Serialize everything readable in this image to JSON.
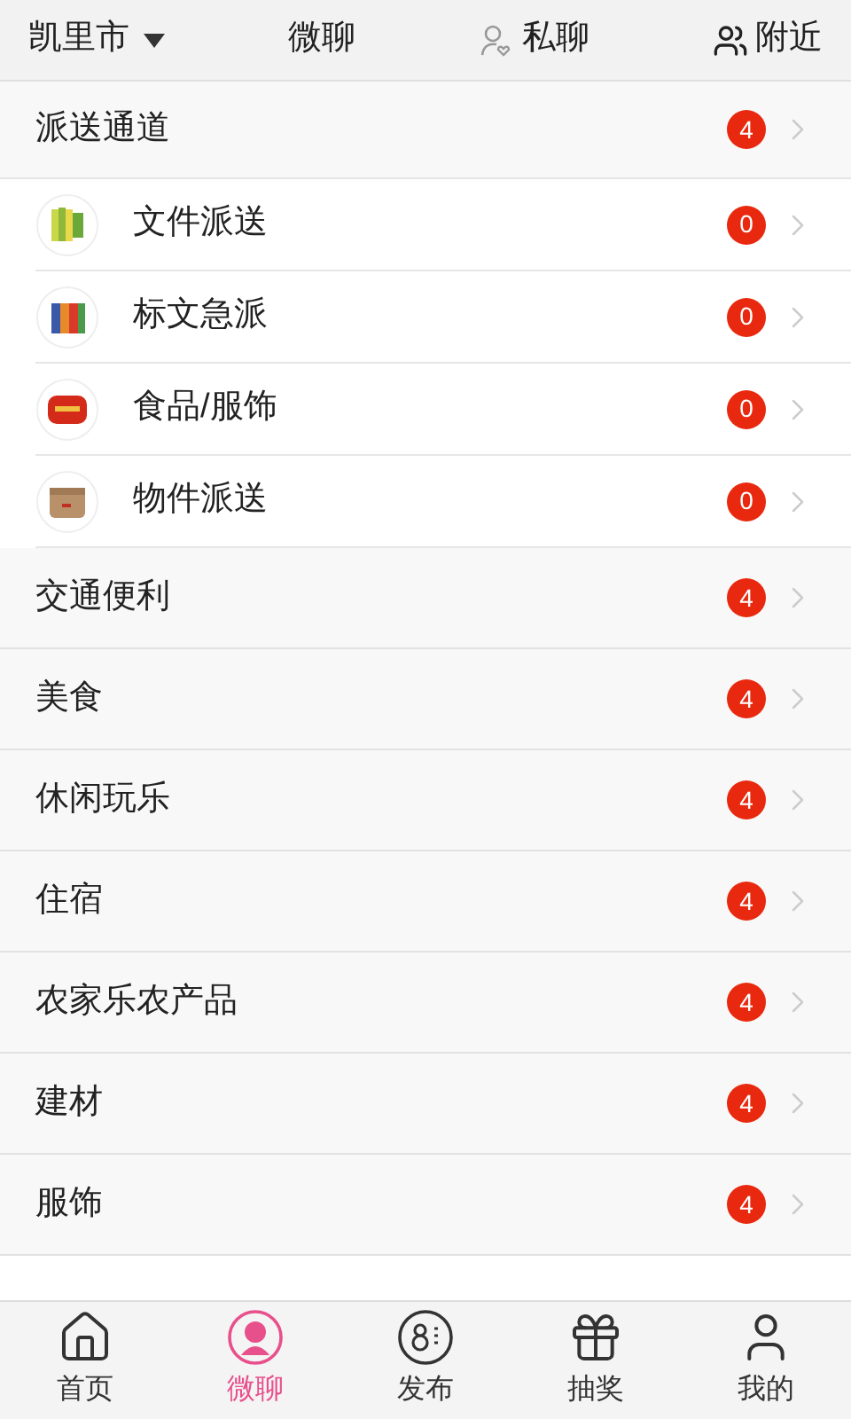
{
  "top_bar": {
    "city": "凯里市",
    "tabs": [
      {
        "label": "微聊"
      },
      {
        "label": "私聊"
      },
      {
        "label": "附近"
      }
    ]
  },
  "section": {
    "title": "派送通道",
    "badge": "4",
    "items": [
      {
        "label": "文件派送",
        "badge": "0",
        "kind": "books"
      },
      {
        "label": "标文急派",
        "badge": "0",
        "kind": "binders"
      },
      {
        "label": "食品/服饰",
        "badge": "0",
        "kind": "redbox"
      },
      {
        "label": "物件派送",
        "badge": "0",
        "kind": "carton"
      }
    ]
  },
  "categories": [
    {
      "label": "交通便利",
      "badge": "4"
    },
    {
      "label": "美食",
      "badge": "4"
    },
    {
      "label": "休闲玩乐",
      "badge": "4"
    },
    {
      "label": "住宿",
      "badge": "4"
    },
    {
      "label": "农家乐农产品",
      "badge": "4"
    },
    {
      "label": "建材",
      "badge": "4"
    },
    {
      "label": "服饰",
      "badge": "4"
    }
  ],
  "bottom_nav": [
    {
      "label": "首页",
      "selected": false
    },
    {
      "label": "微聊",
      "selected": true
    },
    {
      "label": "发布",
      "selected": false
    },
    {
      "label": "抽奖",
      "selected": false
    },
    {
      "label": "我的",
      "selected": false
    }
  ]
}
